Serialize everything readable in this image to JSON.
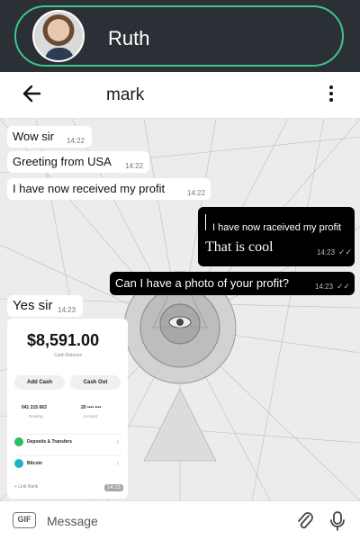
{
  "header": {
    "contact_name": "Ruth"
  },
  "chat_bar": {
    "title": "mark"
  },
  "messages": [
    {
      "text": "Wow sir",
      "time": "14:22"
    },
    {
      "text": "Greeting from USA",
      "time": "14:22"
    },
    {
      "text": "I have now received my profit",
      "time": "14:22"
    },
    {
      "quote": "I have now raceived my profit",
      "text": "That is cool",
      "time": "14:23"
    },
    {
      "text": "Can I have a photo of your profit?",
      "time": "14:23"
    },
    {
      "text": "Yes sir",
      "time": "14:23"
    }
  ],
  "profit_card": {
    "amount": "$8,591.00",
    "subtitle": "Cash Balance",
    "add_cash": "Add Cash",
    "cash_out": "Cash Out",
    "routing_number": "041 215 663",
    "routing_label": "Routing",
    "account_number": "20 •••• ••••",
    "account_label": "Account",
    "row1": "Deposits & Transfers",
    "row2": "Bitcoin",
    "link_bank": "+ Link Bank",
    "time": "14:23"
  },
  "input": {
    "gif_label": "GIF",
    "placeholder": "Message"
  },
  "colors": {
    "header_bg": "#2b3036",
    "accent": "#3fc48a",
    "outgoing": "#000000",
    "incoming": "#ffffff"
  }
}
